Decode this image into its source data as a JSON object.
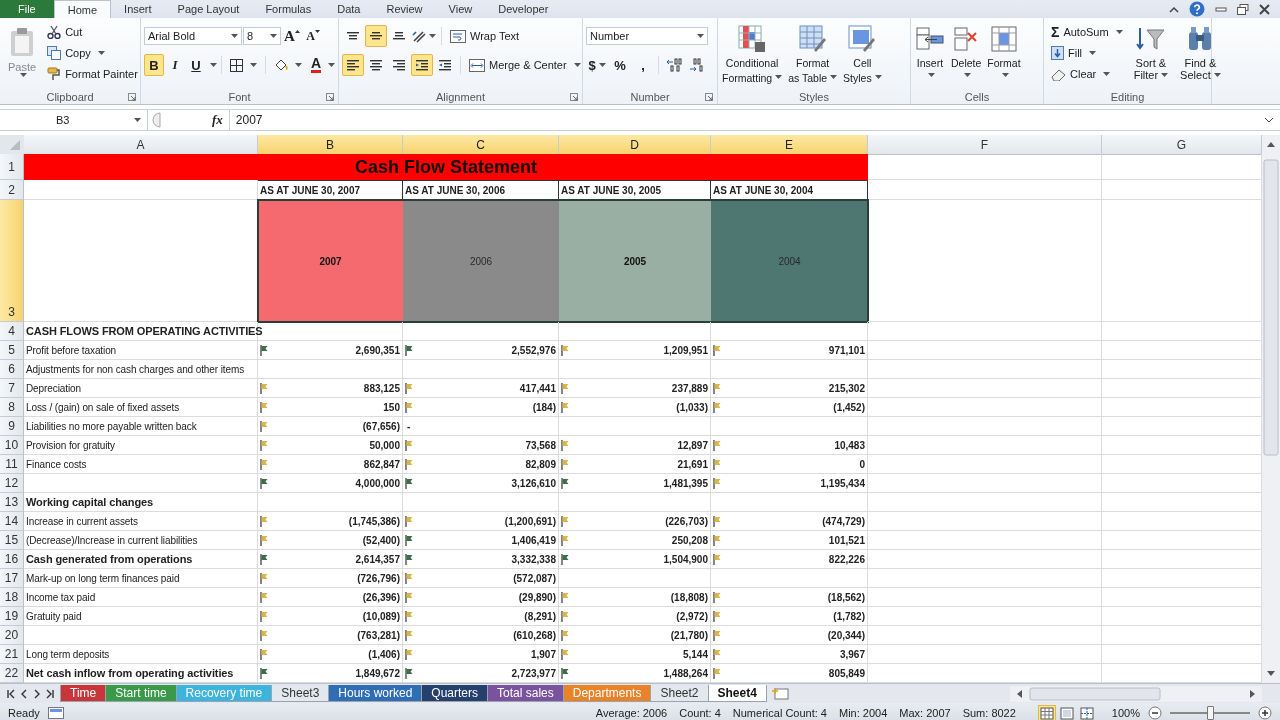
{
  "ribbon_tabs": [
    {
      "label": "File",
      "kind": "file",
      "selected": false
    },
    {
      "label": "Home",
      "kind": "tab",
      "selected": true
    },
    {
      "label": "Insert",
      "kind": "tab",
      "selected": false
    },
    {
      "label": "Page Layout",
      "kind": "tab",
      "selected": false
    },
    {
      "label": "Formulas",
      "kind": "tab",
      "selected": false
    },
    {
      "label": "Data",
      "kind": "tab",
      "selected": false
    },
    {
      "label": "Review",
      "kind": "tab",
      "selected": false
    },
    {
      "label": "View",
      "kind": "tab",
      "selected": false
    },
    {
      "label": "Developer",
      "kind": "tab",
      "selected": false
    }
  ],
  "clipboard": {
    "group": "Clipboard",
    "paste": {
      "label": "Paste",
      "disabled": true
    },
    "cut": "Cut",
    "copy": "Copy",
    "format_painter": "Format Painter"
  },
  "font": {
    "group": "Font",
    "name": "Arial Bold",
    "size": "8",
    "grow": "A",
    "shrink": "A",
    "color_letter": "A",
    "styles": [
      {
        "label": "B",
        "selected": true
      },
      {
        "label": "I",
        "selected": false
      },
      {
        "label": "U",
        "selected": false
      }
    ]
  },
  "alignment": {
    "group": "Alignment",
    "wrap": "Wrap Text",
    "merge": "Merge & Center",
    "top_buttons": [
      {
        "kind": "top",
        "selected": false
      },
      {
        "kind": "middle",
        "selected": true
      },
      {
        "kind": "bottom",
        "selected": false
      },
      {
        "kind": "orientation",
        "selected": false
      }
    ],
    "bottom_buttons": [
      {
        "kind": "left",
        "selected": true
      },
      {
        "kind": "center",
        "selected": false
      },
      {
        "kind": "right",
        "selected": false
      },
      {
        "kind": "indent-decrease",
        "selected": true
      },
      {
        "kind": "indent-increase",
        "selected": false
      }
    ]
  },
  "number": {
    "group": "Number",
    "format": "Number",
    "currency": "$",
    "percent": "%",
    "comma": ","
  },
  "styles": {
    "group": "Styles",
    "buttons": [
      {
        "kind": "conditional",
        "lines": [
          "Conditional",
          "Formatting"
        ]
      },
      {
        "kind": "table",
        "lines": [
          "Format",
          "as Table"
        ]
      },
      {
        "kind": "cell",
        "lines": [
          "Cell",
          "Styles"
        ]
      }
    ]
  },
  "cells": {
    "group": "Cells",
    "buttons": [
      {
        "kind": "insert",
        "label": "Insert"
      },
      {
        "kind": "delete",
        "label": "Delete"
      },
      {
        "kind": "format",
        "label": "Format"
      }
    ]
  },
  "editing": {
    "group": "Editing",
    "sigma": "Σ",
    "autosum": "AutoSum",
    "fill": "Fill",
    "clear": "Clear",
    "sort": [
      "Sort &",
      "Filter"
    ],
    "find": [
      "Find &",
      "Select"
    ]
  },
  "formula_bar": {
    "name_box": "B3",
    "fx": "fx",
    "formula": "2007"
  },
  "columns": [
    {
      "label": "A",
      "selected": false
    },
    {
      "label": "B",
      "selected": true
    },
    {
      "label": "C",
      "selected": true
    },
    {
      "label": "D",
      "selected": true
    },
    {
      "label": "E",
      "selected": true
    },
    {
      "label": "F",
      "selected": false
    },
    {
      "label": "G",
      "selected": false
    }
  ],
  "title_row": {
    "num": "1",
    "text": "Cash Flow Statement"
  },
  "caption_row": {
    "num": "2",
    "captions": [
      "AS AT JUNE 30, 2007",
      "AS AT JUNE 30, 2006",
      "AS AT JUNE 30, 2005",
      "AS AT JUNE 30, 2004"
    ]
  },
  "year_row": {
    "num": "3",
    "selected": true,
    "cells": [
      {
        "text": "2007",
        "color": "#f46a6e",
        "bold": true
      },
      {
        "text": "2006",
        "color": "#8a8a8a",
        "bold": false
      },
      {
        "text": "2005",
        "color": "#9aafa4",
        "bold": true
      },
      {
        "text": "2004",
        "color": "#4d7770",
        "bold": false
      }
    ]
  },
  "rows": [
    {
      "num": "4",
      "label": "CASH FLOWS FROM OPERATING ACTIVITIES",
      "bold": true,
      "cells": [
        null,
        null,
        null,
        null
      ]
    },
    {
      "num": "5",
      "label": "Profit before taxation",
      "bold": false,
      "cells": [
        {
          "value": "2,690,351",
          "color": "#3d6e45"
        },
        {
          "value": "2,552,976",
          "color": "#3d6e45"
        },
        {
          "value": "1,209,951",
          "color": "#d9b64c"
        },
        {
          "value": "971,101",
          "color": "#d9b64c"
        }
      ]
    },
    {
      "num": "6",
      "label": "Adjustments for non cash charges and other items",
      "bold": false,
      "cells": [
        null,
        null,
        null,
        null
      ]
    },
    {
      "num": "7",
      "label": "Depreciation",
      "bold": false,
      "cells": [
        {
          "value": "883,125",
          "color": "#d9b64c"
        },
        {
          "value": "417,441",
          "color": "#d9b64c"
        },
        {
          "value": "237,889",
          "color": "#d9b64c"
        },
        {
          "value": "215,302",
          "color": "#d9b64c"
        }
      ]
    },
    {
      "num": "8",
      "label": "Loss / (gain) on sale of fixed assets",
      "bold": false,
      "cells": [
        {
          "value": "150",
          "color": "#d9b64c"
        },
        {
          "value": "(184)",
          "color": "#d9b64c"
        },
        {
          "value": "(1,033)",
          "color": "#d9b64c"
        },
        {
          "value": "(1,452)",
          "color": "#d9b64c"
        }
      ]
    },
    {
      "num": "9",
      "label": "Liabilities no more payable written back",
      "bold": false,
      "cells": [
        {
          "value": "(67,656)",
          "color": "#d9b64c"
        },
        {
          "value": "-",
          "left_aligned": true
        },
        null,
        null
      ]
    },
    {
      "num": "10",
      "label": "Provision for gratuity",
      "bold": false,
      "cells": [
        {
          "value": "50,000",
          "color": "#d9b64c"
        },
        {
          "value": "73,568",
          "color": "#d9b64c"
        },
        {
          "value": "12,897",
          "color": "#d9b64c"
        },
        {
          "value": "10,483",
          "color": "#d9b64c"
        }
      ]
    },
    {
      "num": "11",
      "label": "Finance costs",
      "bold": false,
      "cells": [
        {
          "value": "862,847",
          "color": "#d9b64c"
        },
        {
          "value": "82,809",
          "color": "#d9b64c"
        },
        {
          "value": "21,691",
          "color": "#d9b64c"
        },
        {
          "value": "0",
          "color": "#d9b64c"
        }
      ]
    },
    {
      "num": "12",
      "cells": [
        {
          "value": "4,000,000",
          "color": "#3d6e45"
        },
        {
          "value": "3,126,610",
          "color": "#3d6e45"
        },
        {
          "value": "1,481,395",
          "color": "#3d6e45"
        },
        {
          "value": "1,195,434",
          "color": "#d9b64c"
        }
      ]
    },
    {
      "num": "13",
      "label": "Working capital changes",
      "bold": true,
      "cells": [
        null,
        null,
        null,
        null
      ]
    },
    {
      "num": "14",
      "label": "Increase in current assets",
      "bold": false,
      "cells": [
        {
          "value": "(1,745,386)",
          "color": "#d9b64c"
        },
        {
          "value": "(1,200,691)",
          "color": "#d9b64c"
        },
        {
          "value": "(226,703)",
          "color": "#d9b64c"
        },
        {
          "value": "(474,729)",
          "color": "#d9b64c"
        }
      ]
    },
    {
      "num": "15",
      "label": "(Decrease)/Increase in current liabilities",
      "bold": false,
      "cells": [
        {
          "value": "(52,400)",
          "color": "#d9b64c"
        },
        {
          "value": "1,406,419",
          "color": "#3d6e45"
        },
        {
          "value": "250,208",
          "color": "#d9b64c"
        },
        {
          "value": "101,521",
          "color": "#d9b64c"
        }
      ]
    },
    {
      "num": "16",
      "label": "Cash generated from operations",
      "bold": true,
      "cells": [
        {
          "value": "2,614,357",
          "color": "#3d6e45"
        },
        {
          "value": "3,332,338",
          "color": "#3d6e45"
        },
        {
          "value": "1,504,900",
          "color": "#3d6e45"
        },
        {
          "value": "822,226",
          "color": "#d9b64c"
        }
      ]
    },
    {
      "num": "17",
      "label": "Mark-up on long term finances paid",
      "bold": false,
      "cells": [
        {
          "value": "(726,796)",
          "color": "#d9b64c"
        },
        {
          "value": "(572,087)",
          "color": "#d9b64c"
        },
        null,
        null
      ]
    },
    {
      "num": "18",
      "label": "Income tax paid",
      "bold": false,
      "cells": [
        {
          "value": "(26,396)",
          "color": "#d9b64c"
        },
        {
          "value": "(29,890)",
          "color": "#d9b64c"
        },
        {
          "value": "(18,808)",
          "color": "#d9b64c"
        },
        {
          "value": "(18,562)",
          "color": "#d9b64c"
        }
      ]
    },
    {
      "num": "19",
      "label": "Gratuity paid",
      "bold": false,
      "cells": [
        {
          "value": "(10,089)",
          "color": "#d9b64c"
        },
        {
          "value": "(8,291)",
          "color": "#d9b64c"
        },
        {
          "value": "(2,972)",
          "color": "#d9b64c"
        },
        {
          "value": "(1,782)",
          "color": "#d9b64c"
        }
      ]
    },
    {
      "num": "20",
      "cells": [
        {
          "value": "(763,281)",
          "color": "#d9b64c"
        },
        {
          "value": "(610,268)",
          "color": "#d9b64c"
        },
        {
          "value": "(21,780)",
          "color": "#d9b64c"
        },
        {
          "value": "(20,344)",
          "color": "#d9b64c"
        }
      ]
    },
    {
      "num": "21",
      "label": "Long term deposits",
      "bold": false,
      "cells": [
        {
          "value": "(1,406)",
          "color": "#d9b64c"
        },
        {
          "value": "1,907",
          "color": "#d9b64c"
        },
        {
          "value": "5,144",
          "color": "#d9b64c"
        },
        {
          "value": "3,967",
          "color": "#d9b64c"
        }
      ]
    },
    {
      "num": "22",
      "label": "Net cash inflow from operating activities",
      "bold": true,
      "cells": [
        {
          "value": "1,849,672",
          "color": "#3d6e45"
        },
        {
          "value": "2,723,977",
          "color": "#3d6e45"
        },
        {
          "value": "1,488,264",
          "color": "#3d6e45"
        },
        {
          "value": "805,849",
          "color": "#d9b64c"
        }
      ]
    }
  ],
  "sheet_tabs": [
    {
      "label": "Time",
      "color": "#c8353a",
      "selected": false
    },
    {
      "label": "Start time",
      "color": "#3a9a4a",
      "selected": false
    },
    {
      "label": "Recovery time",
      "color": "#3cb4de",
      "selected": false
    },
    {
      "label": "Sheet3",
      "selected": false
    },
    {
      "label": "Hours worked",
      "color": "#2f6db5",
      "selected": false
    },
    {
      "label": "Quarters",
      "color": "#26406e",
      "selected": false
    },
    {
      "label": "Total sales",
      "color": "#7b529e",
      "selected": false
    },
    {
      "label": "Departments",
      "color": "#e8832a",
      "selected": false
    },
    {
      "label": "Sheet2",
      "selected": false
    },
    {
      "label": "Sheet4",
      "selected": true
    }
  ],
  "status_bar": {
    "mode": "Ready",
    "stats": [
      "Average: 2006",
      "Count: 4",
      "Numerical Count: 4",
      "Min: 2004",
      "Max: 2007",
      "Sum: 8022"
    ],
    "views": [
      {
        "kind": "normal",
        "selected": true
      },
      {
        "kind": "layout",
        "selected": false
      },
      {
        "kind": "break",
        "selected": false
      }
    ],
    "zoom": "100%",
    "zoom_level": {
      "level": 0.5
    }
  }
}
